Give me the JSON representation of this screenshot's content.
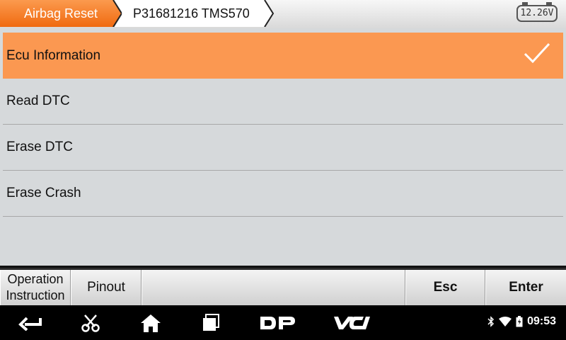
{
  "breadcrumb": {
    "active": "Airbag Reset",
    "second": "P31681216 TMS570"
  },
  "battery": {
    "voltage": "12.26V"
  },
  "menu": {
    "items": [
      {
        "label": "Ecu Information",
        "selected": true
      },
      {
        "label": "Read DTC",
        "selected": false
      },
      {
        "label": "Erase DTC",
        "selected": false
      },
      {
        "label": "Erase Crash",
        "selected": false
      }
    ]
  },
  "function_bar": {
    "operation_line1": "Operation",
    "operation_line2": "Instruction",
    "pinout": "Pinout",
    "esc": "Esc",
    "enter": "Enter"
  },
  "nav": {
    "icons": [
      "back-icon",
      "scissors-icon",
      "home-icon",
      "recent-apps-icon",
      "dp-icon",
      "vci-icon"
    ],
    "dp_label": "DP",
    "vci_label": "VCI"
  },
  "status": {
    "time": "09:53"
  },
  "colors": {
    "accent": "#fb9851",
    "active_tab": "#f47b20",
    "panel_bg": "#d6d9db"
  }
}
